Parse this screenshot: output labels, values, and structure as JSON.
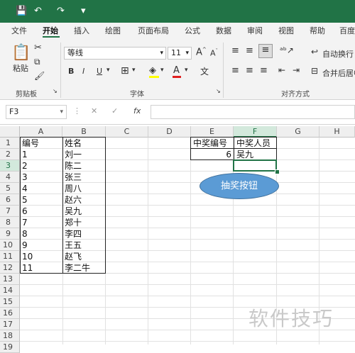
{
  "titlebar": {
    "save": "💾",
    "undo": "↶",
    "redo": "↷",
    "customize": "₹"
  },
  "tabs": [
    "文件",
    "开始",
    "插入",
    "绘图",
    "页面布局",
    "公式",
    "数据",
    "审阅",
    "视图",
    "帮助",
    "百度"
  ],
  "ribbon": {
    "paste": "粘贴",
    "clipboard": "剪贴板",
    "font_name": "等线",
    "font_size": "11",
    "font_group": "字体",
    "bold": "B",
    "italic": "I",
    "underline": "U",
    "grow": "A",
    "shrink": "A",
    "wrap": "自动换行",
    "merge": "合并后居中",
    "align_group": "对齐方式"
  },
  "formula": {
    "namebox": "F3",
    "fx": "fx",
    "cancel": "✕",
    "enter": "✓",
    "value": ""
  },
  "columns": [
    "A",
    "B",
    "C",
    "D",
    "E",
    "F",
    "G",
    "H"
  ],
  "rows": [
    "1",
    "2",
    "3",
    "4",
    "5",
    "6",
    "7",
    "8",
    "9",
    "10",
    "11",
    "12",
    "13",
    "14",
    "15",
    "16",
    "17",
    "18",
    "19"
  ],
  "table": {
    "header": [
      "编号",
      "姓名"
    ],
    "rows": [
      [
        "1",
        "刘一"
      ],
      [
        "2",
        "陈二"
      ],
      [
        "3",
        "张三"
      ],
      [
        "4",
        "周八"
      ],
      [
        "5",
        "赵六"
      ],
      [
        "6",
        "吴九"
      ],
      [
        "7",
        "郑十"
      ],
      [
        "8",
        "李四"
      ],
      [
        "9",
        "王五"
      ],
      [
        "10",
        "赵飞"
      ],
      [
        "11",
        "李二牛"
      ]
    ]
  },
  "lottery": {
    "header": [
      "中奖编号",
      "中奖人员"
    ],
    "number": "6",
    "winner": "吴九"
  },
  "button_label": "抽奖按钮",
  "watermark": "软件技巧"
}
